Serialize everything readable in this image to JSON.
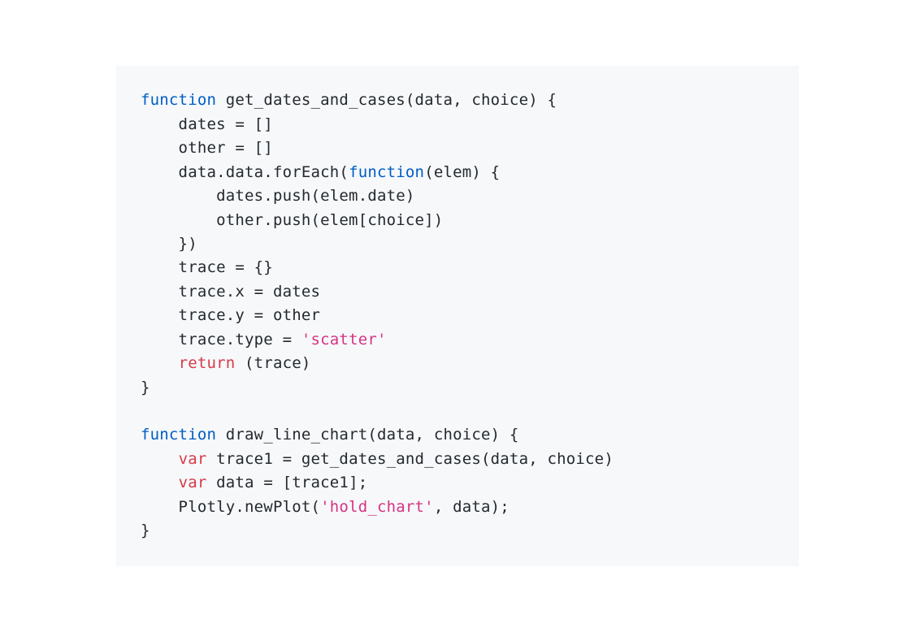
{
  "code": {
    "lines": [
      [
        {
          "class": "fn",
          "text": "function"
        },
        {
          "class": "txt",
          "text": " get_dates_and_cases(data, choice) {"
        }
      ],
      [
        {
          "class": "txt",
          "text": "    dates = []"
        }
      ],
      [
        {
          "class": "txt",
          "text": "    other = []"
        }
      ],
      [
        {
          "class": "txt",
          "text": "    data.data.forEach("
        },
        {
          "class": "fn",
          "text": "function"
        },
        {
          "class": "txt",
          "text": "(elem) {"
        }
      ],
      [
        {
          "class": "txt",
          "text": "        dates.push(elem.date)"
        }
      ],
      [
        {
          "class": "txt",
          "text": "        other.push(elem[choice])"
        }
      ],
      [
        {
          "class": "txt",
          "text": "    })"
        }
      ],
      [
        {
          "class": "txt",
          "text": "    trace = {}"
        }
      ],
      [
        {
          "class": "txt",
          "text": "    trace.x = dates"
        }
      ],
      [
        {
          "class": "txt",
          "text": "    trace.y = other"
        }
      ],
      [
        {
          "class": "txt",
          "text": "    trace.type = "
        },
        {
          "class": "str",
          "text": "'scatter'"
        }
      ],
      [
        {
          "class": "txt",
          "text": "    "
        },
        {
          "class": "kw",
          "text": "return"
        },
        {
          "class": "txt",
          "text": " (trace)"
        }
      ],
      [
        {
          "class": "txt",
          "text": "}"
        }
      ],
      [
        {
          "class": "txt",
          "text": ""
        }
      ],
      [
        {
          "class": "fn",
          "text": "function"
        },
        {
          "class": "txt",
          "text": " draw_line_chart(data, choice) {"
        }
      ],
      [
        {
          "class": "txt",
          "text": "    "
        },
        {
          "class": "kw",
          "text": "var"
        },
        {
          "class": "txt",
          "text": " trace1 = get_dates_and_cases(data, choice)"
        }
      ],
      [
        {
          "class": "txt",
          "text": "    "
        },
        {
          "class": "kw",
          "text": "var"
        },
        {
          "class": "txt",
          "text": " data = [trace1];"
        }
      ],
      [
        {
          "class": "txt",
          "text": "    Plotly.newPlot("
        },
        {
          "class": "str",
          "text": "'hold_chart'"
        },
        {
          "class": "txt",
          "text": ", data);"
        }
      ],
      [
        {
          "class": "txt",
          "text": "}"
        }
      ]
    ]
  }
}
